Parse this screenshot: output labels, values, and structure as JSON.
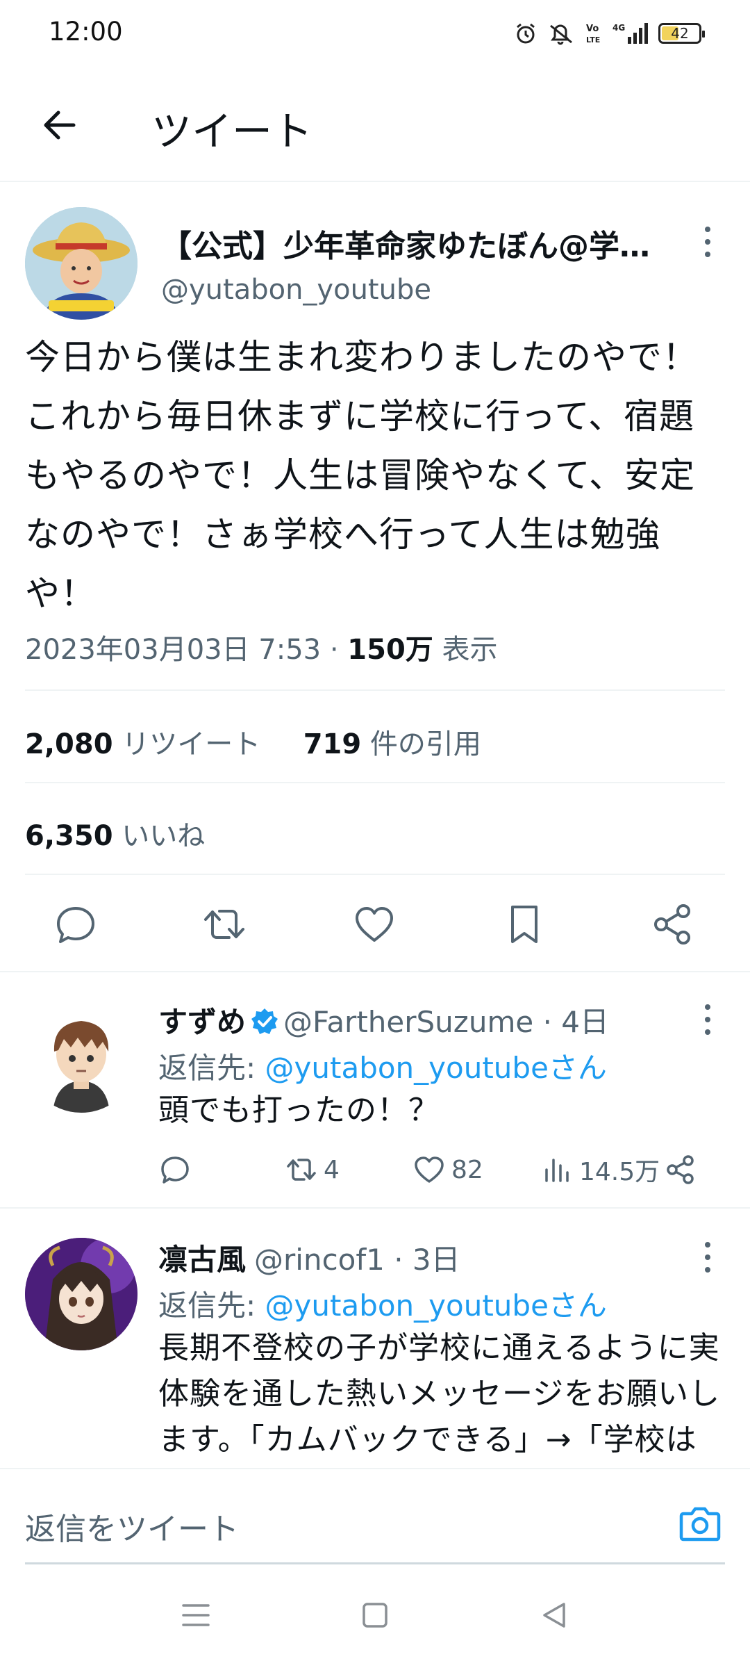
{
  "status_bar": {
    "time": "12:00",
    "icons": [
      "alarm-icon",
      "mute-icon",
      "volte-icon",
      "4g-signal-icon",
      "battery-icon"
    ],
    "network": "4G",
    "battery_level": "42"
  },
  "app_bar": {
    "title": "ツイート",
    "back_icon": "arrow-left-icon"
  },
  "tweet": {
    "display_name": "【公式】少年革命家ゆたぼん@学…",
    "handle": "@yutabon_youtube",
    "text": "今日から僕は生まれ変わりましたのやで！これから毎日休まずに学校に行って、宿題もやるのやで！人生は冒険やなくて、安定なのやで！さぁ学校へ行って人生は勉強や！",
    "timestamp": "2023年03月03日 7:53 · ",
    "views_count": "150万",
    "views_label": " 表示",
    "retweets_count": "2,080",
    "retweets_label": " リツイート",
    "quotes_count": "719",
    "quotes_label": " 件の引用",
    "likes_count": "6,350",
    "likes_label": " いいね",
    "actions": [
      "reply-icon",
      "retweet-icon",
      "like-icon",
      "bookmark-icon",
      "share-icon"
    ]
  },
  "replies": [
    {
      "name": "すずめ",
      "verified": true,
      "handle": "@FartherSuzume",
      "time": " · 4日",
      "reply_to_label": "返信先: ",
      "reply_to_handle": "@yutabon_youtubeさん",
      "text": "頭でも打ったの！？",
      "reply_count": "",
      "retweet_count": "4",
      "like_count": "82",
      "view_count": "14.5万"
    },
    {
      "name": "凛古風",
      "verified": false,
      "handle": "@rincof1",
      "time": " · 3日",
      "reply_to_label": "返信先: ",
      "reply_to_handle": "@yutabon_youtubeさん",
      "text": "長期不登校の子が学校に通えるように実体験を通した熱いメッセージをお願いします。「カムバックできる」→「学校は休んでもいい」につながると私は思いま"
    }
  ],
  "composer": {
    "placeholder": "返信をツイート",
    "camera_icon": "camera-icon"
  },
  "nav_bar": {
    "icons": [
      "menu-icon",
      "home-square-icon",
      "back-triangle-icon"
    ]
  },
  "colors": {
    "accent": "#1d9bf0",
    "text_primary": "#0f1419",
    "text_secondary": "#536471",
    "divider": "#eff3f4"
  }
}
